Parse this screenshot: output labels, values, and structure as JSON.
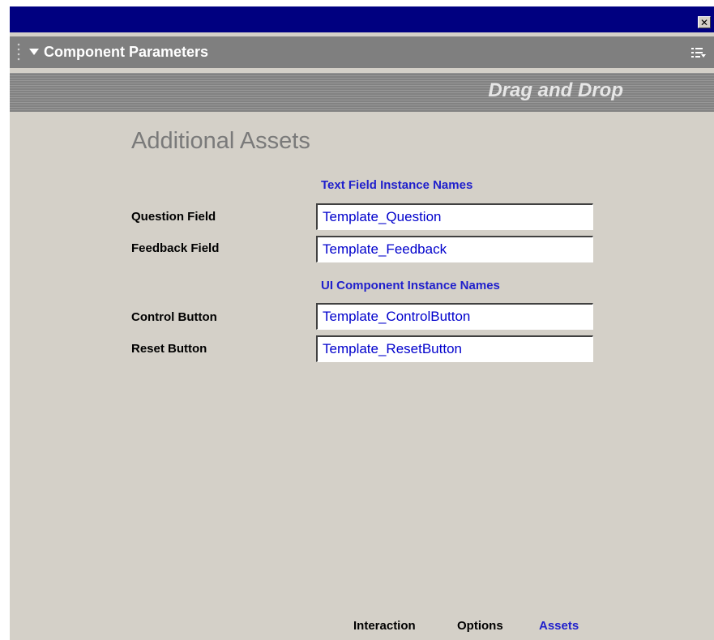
{
  "window": {
    "close_glyph": "✕"
  },
  "panel": {
    "title": "Component Parameters",
    "grip_icon": "drag-grip-icon",
    "collapse_icon": "triangle-down-icon",
    "menu_icon": "options-menu-icon"
  },
  "banner": {
    "title": "Drag and Drop"
  },
  "section": {
    "title": "Additional Assets"
  },
  "groups": {
    "text_fields_header": "Text Field Instance Names",
    "ui_components_header": "UI Component Instance Names"
  },
  "rows": [
    {
      "label": "Question Field",
      "value": "Template_Question"
    },
    {
      "label": "Feedback Field",
      "value": "Template_Feedback"
    },
    {
      "label": "Control Button",
      "value": "Template_ControlButton"
    },
    {
      "label": "Reset Button",
      "value": "Template_ResetButton"
    }
  ],
  "tabs": [
    {
      "label": "Interaction",
      "active": false
    },
    {
      "label": "Options",
      "active": false
    },
    {
      "label": "Assets",
      "active": true
    }
  ],
  "colors": {
    "titlebar": "#000080",
    "panel_header": "#7f7f7f",
    "background": "#d4d0c8",
    "accent_blue": "#2020cc"
  }
}
